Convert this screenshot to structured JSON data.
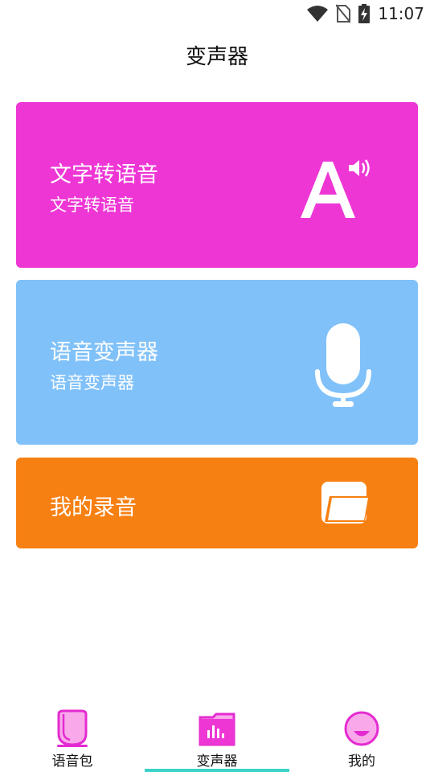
{
  "status_bar": {
    "time": "11:07"
  },
  "header": {
    "title": "变声器"
  },
  "cards": [
    {
      "title": "文字转语音",
      "subtitle": "文字转语音",
      "icon": "text-to-speech-icon",
      "color": "#ee36d5"
    },
    {
      "title": "语音变声器",
      "subtitle": "语音变声器",
      "icon": "microphone-icon",
      "color": "#80c1f9"
    },
    {
      "title": "我的录音",
      "icon": "folder-icon",
      "color": "#f78012"
    }
  ],
  "bottom_nav": {
    "items": [
      {
        "label": "语音包",
        "icon": "voice-pack-icon"
      },
      {
        "label": "变声器",
        "icon": "voice-changer-icon",
        "active": true
      },
      {
        "label": "我的",
        "icon": "profile-icon"
      }
    ],
    "active_indicator_color": "#3ad3c9"
  }
}
